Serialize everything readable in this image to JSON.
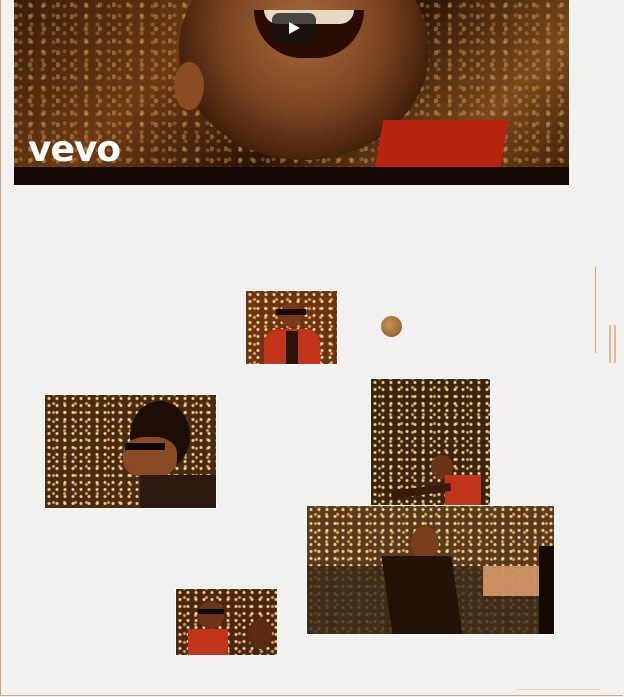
{
  "video": {
    "brand_logo": "vevo",
    "play_button": "play-icon"
  },
  "collage": {
    "photos": [
      {
        "name": "collage-photo-smiling-red-jacket"
      },
      {
        "name": "collage-photo-profile-glasses"
      },
      {
        "name": "collage-photo-arms-spread-ceiling-lights"
      },
      {
        "name": "collage-photo-casino-floor"
      },
      {
        "name": "collage-photo-two-people-laughing"
      }
    ],
    "decorative_orb": "orb"
  },
  "colors": {
    "background": "#f2f1ef",
    "accent_red": "#c2341a",
    "warm_gold": "#c99256"
  }
}
